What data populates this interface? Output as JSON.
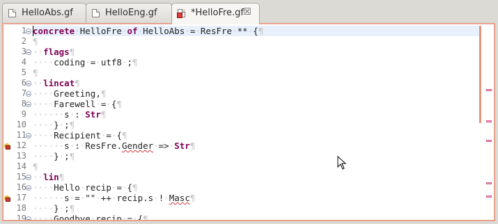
{
  "tabs": [
    {
      "label": "HelloAbs.gf",
      "active": false,
      "has_error": false
    },
    {
      "label": "HelloEng.gf",
      "active": false,
      "has_error": false
    },
    {
      "label": "*HelloFre.gf",
      "active": true,
      "has_error": true
    }
  ],
  "close_glyph": "☒",
  "editor": {
    "lines": [
      {
        "n": "1",
        "fold": true,
        "html": "<span class='kw'>concrete</span><span class='ws'>·</span>HelloFre<span class='ws'>·</span><span class='kw'>of</span><span class='ws'>·</span>HelloAbs<span class='ws'>·</span>=<span class='ws'>·</span>ResFre<span class='ws'>·</span>**<span class='ws'>·</span>{<span class='pil'>¶</span>",
        "current": true
      },
      {
        "n": "2",
        "fold": false,
        "html": "<span class='pil'>¶</span>"
      },
      {
        "n": "3",
        "fold": true,
        "html": "<span class='ws'>··</span><span class='kw'>flags</span><span class='pil'>¶</span>"
      },
      {
        "n": "4",
        "fold": false,
        "html": "<span class='ws'>····</span>coding<span class='ws'>·</span>=<span class='ws'>·</span>utf8<span class='ws'>·</span>;<span class='pil'>¶</span>"
      },
      {
        "n": "5",
        "fold": false,
        "html": "<span class='pil'>¶</span>"
      },
      {
        "n": "6",
        "fold": true,
        "html": "<span class='ws'>··</span><span class='kw'>lincat</span><span class='pil'>¶</span>"
      },
      {
        "n": "7",
        "fold": true,
        "html": "<span class='ws'>····</span>Greeting,<span class='pil'>¶</span>"
      },
      {
        "n": "8",
        "fold": true,
        "html": "<span class='ws'>····</span>Farewell<span class='ws'>·</span>=<span class='ws'>·</span>{<span class='pil'>¶</span>"
      },
      {
        "n": "9",
        "fold": false,
        "html": "<span class='ws'>······</span>s<span class='ws'>·</span>:<span class='ws'>·</span><span class='kw'>Str</span><span class='pil'>¶</span>"
      },
      {
        "n": "10",
        "fold": false,
        "html": "<span class='ws'>····</span>}<span class='ws'>·</span>;<span class='pil'>¶</span>"
      },
      {
        "n": "11",
        "fold": true,
        "html": "<span class='ws'>····</span>Recipient<span class='ws'>·</span>=<span class='ws'>·</span>{<span class='pil'>¶</span>"
      },
      {
        "n": "12",
        "fold": false,
        "html": "<span class='ws'>······</span>s<span class='ws'>·</span>:<span class='ws'>·</span>ResFre.<span class='err'>Gender</span><span class='ws'>·</span>=&gt;<span class='ws'>·</span><span class='kw'>Str</span><span class='pil'>¶</span>",
        "marker": true
      },
      {
        "n": "13",
        "fold": false,
        "html": "<span class='ws'>····</span>}<span class='ws'>·</span>;<span class='pil'>¶</span>"
      },
      {
        "n": "14",
        "fold": false,
        "html": "<span class='pil'>¶</span>"
      },
      {
        "n": "15",
        "fold": true,
        "html": "<span class='ws'>··</span><span class='kw'>lin</span><span class='pil'>¶</span>"
      },
      {
        "n": "16",
        "fold": true,
        "html": "<span class='ws'>····</span>Hello<span class='ws'>·</span>recip<span class='ws'>·</span>=<span class='ws'>·</span>{<span class='pil'>¶</span>"
      },
      {
        "n": "17",
        "fold": false,
        "html": "<span class='ws'>······</span>s<span class='ws'>·</span>=<span class='ws'>·</span>\"\"<span class='ws'>·</span>++<span class='ws'>·</span>recip.s<span class='ws'>·</span>!<span class='ws'>·</span><span class='err'>Masc</span><span class='pil'>¶</span>",
        "marker": true
      },
      {
        "n": "18",
        "fold": false,
        "html": "<span class='ws'>····</span>}<span class='ws'>·</span>;<span class='pil'>¶</span>"
      },
      {
        "n": "19",
        "fold": true,
        "html": "<span class='ws'>····</span>Goodbye<span class='ws'>·</span>recip<span class='ws'>·</span>=<span class='ws'>·</span>{<span class='pil'>¶</span>"
      }
    ]
  },
  "overview_marks_count": 5,
  "colors": {
    "accent_border": "#e8a18c",
    "keyword": "#7f0055",
    "current_line": "#e8f0fb"
  }
}
